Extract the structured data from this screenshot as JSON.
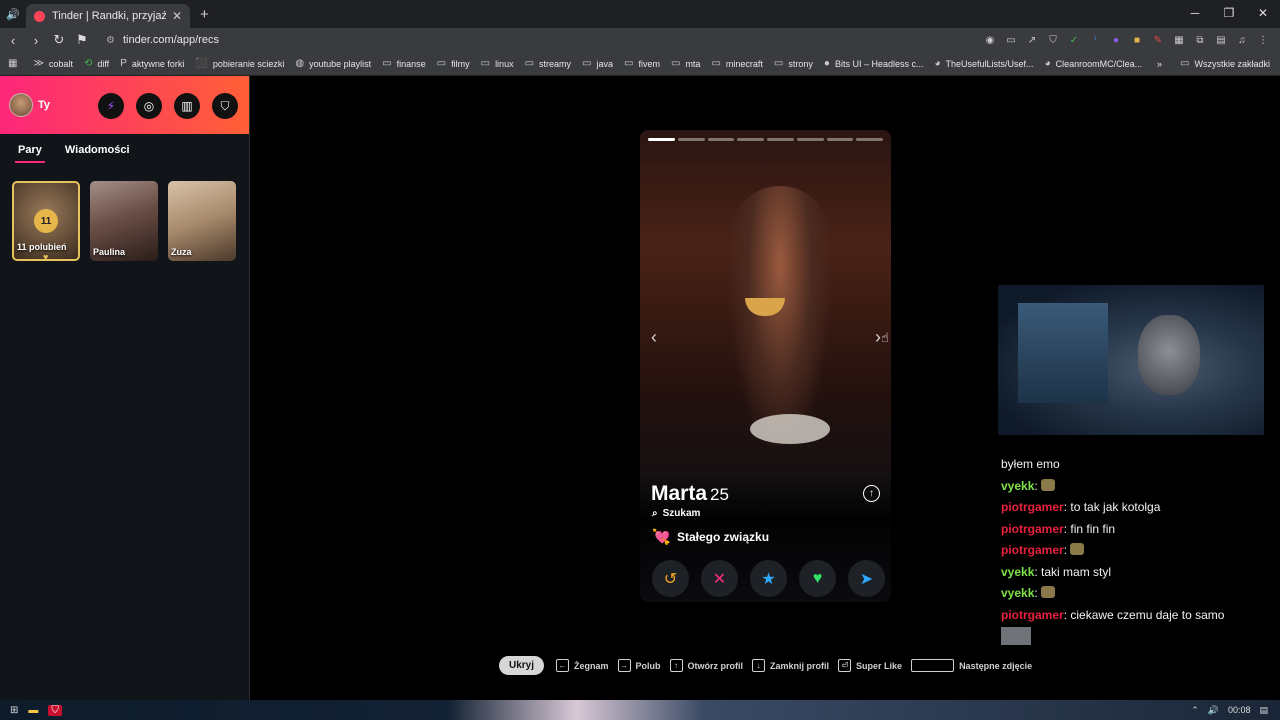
{
  "browser": {
    "tab_title": "Tinder | Randki, przyjaźń, nowe z",
    "url": "tinder.com/app/recs",
    "bookmarks": [
      "cobalt",
      "diff",
      "aktywne forki",
      "pobieranie sciezki",
      "youtube playlist",
      "finanse",
      "filmy",
      "linux",
      "streamy",
      "java",
      "fivem",
      "mta",
      "minecraft",
      "strony",
      "Bits UI – Headless c...",
      "TheUsefulLists/Usef...",
      "CleanroomMC/Clea..."
    ],
    "bookmarks_right": "Wszystkie zakładki"
  },
  "sidebar": {
    "user_label": "Ty",
    "tabs": [
      "Pary",
      "Wiadomości"
    ],
    "likes_count": "11",
    "likes_label": "11 polubień",
    "matches": [
      "Paulina",
      "Zuza"
    ]
  },
  "profile": {
    "name": "Marta",
    "age": "25",
    "seeking_label": "Szukam",
    "goal": "Stałego związku",
    "photo_count": 8,
    "current_photo": 1
  },
  "chat": [
    {
      "user": "",
      "text": "byłem emo",
      "color": "none"
    },
    {
      "user": "vyekk",
      "text": ": ",
      "emote": true,
      "color": "green"
    },
    {
      "user": "piotrgamer",
      "text": ": to tak jak kotolga",
      "color": "red"
    },
    {
      "user": "piotrgamer",
      "text": ": fin fin fin",
      "color": "red"
    },
    {
      "user": "piotrgamer",
      "text": ": ",
      "emote": true,
      "color": "red"
    },
    {
      "user": "vyekk",
      "text": ": taki mam styl",
      "color": "green"
    },
    {
      "user": "vyekk",
      "text": ": ",
      "emote": true,
      "color": "green"
    },
    {
      "user": "piotrgamer",
      "text": ": ciekawe czemu daje to samo",
      "color": "red"
    }
  ],
  "hints": {
    "hide": "Ukryj",
    "items": [
      "Żegnam",
      "Polub",
      "Otwórz profil",
      "Zamknij profil",
      "Super Like",
      "Następne zdjęcie"
    ]
  },
  "taskbar": {
    "time": "00:08"
  },
  "colors": {
    "brand_start": "#fd267a",
    "brand_end": "#ff6036",
    "chat_green": "#7fe34a",
    "chat_red": "#e8213c"
  }
}
